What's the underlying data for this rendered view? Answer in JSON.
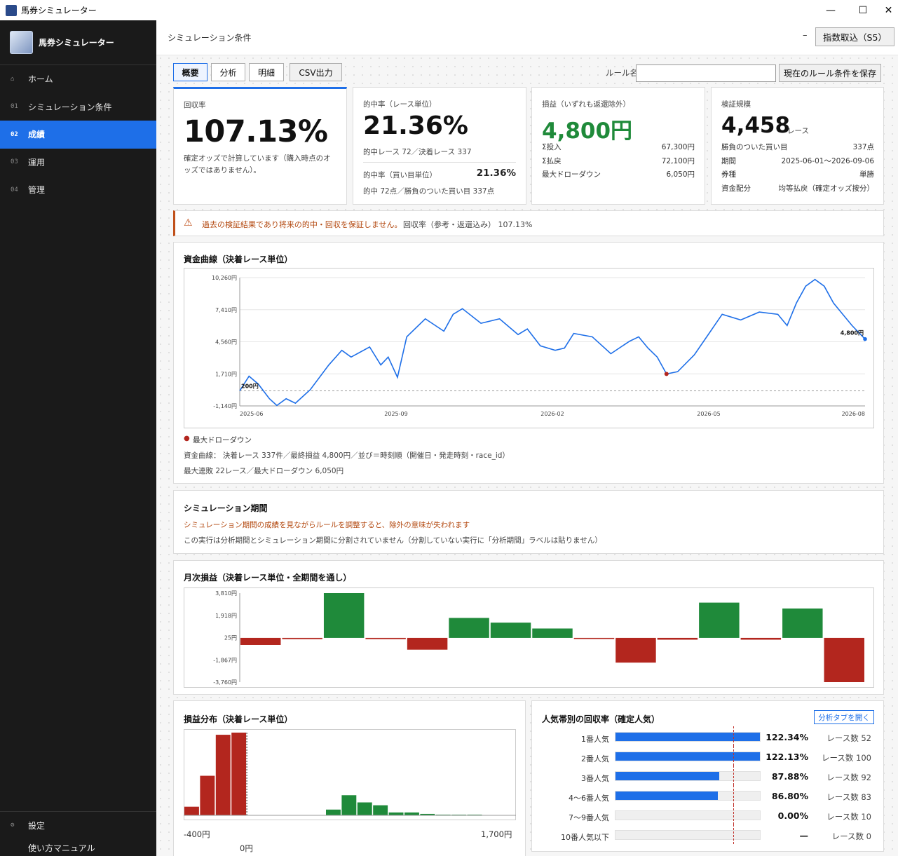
{
  "window": {
    "title": "馬券シミュレーター",
    "minimize": "—",
    "maximize": "☐",
    "close": "✕"
  },
  "sidebar": {
    "brand": "馬券シミュレーター",
    "items": [
      {
        "num": "",
        "label": "ホーム",
        "icon": "home-icon"
      },
      {
        "num": "01",
        "label": "シミュレーション条件"
      },
      {
        "num": "02",
        "label": "成績"
      },
      {
        "num": "03",
        "label": "運用"
      },
      {
        "num": "04",
        "label": "管理"
      }
    ],
    "settings": "設定",
    "manual": "使い方マニュアル"
  },
  "header": {
    "title": "シミュレーション条件",
    "minus": "–",
    "import_button": "指数取込（S5）"
  },
  "tabs": [
    {
      "label": "概要"
    },
    {
      "label": "分析"
    },
    {
      "label": "明細"
    }
  ],
  "csv_button": "CSV出力",
  "rule": {
    "label": "ルール名",
    "value": "",
    "save_button": "現在のルール条件を保存"
  },
  "kpi": {
    "roi": {
      "title": "回収率",
      "value": "107.13%",
      "note": "確定オッズで計算しています（購入時点のオッズではありません）。"
    },
    "hit": {
      "title": "的中率（レース単位）",
      "value": "21.36%",
      "sub": "的中レース 72／決着レース 337",
      "bet_label": "的中率（買い目単位）",
      "bet_value": "21.36%",
      "bet_sub": "的中 72点／勝負のついた買い目 337点"
    },
    "pl": {
      "title": "損益（いずれも返還除外）",
      "value": "4,800円",
      "rows": [
        {
          "k": "Σ投入",
          "v": "67,300円"
        },
        {
          "k": "Σ払戻",
          "v": "72,100円"
        },
        {
          "k": "最大ドローダウン",
          "v": "6,050円"
        }
      ]
    },
    "scale": {
      "title": "検証規模",
      "value": "4,458",
      "unit": "レース",
      "rows": [
        {
          "k": "勝負のついた買い目",
          "v": "337点"
        },
        {
          "k": "期間",
          "v": "2025-06-01～2026-09-06"
        },
        {
          "k": "券種",
          "v": "単勝"
        },
        {
          "k": "資金配分",
          "v": "均等払戻（確定オッズ按分）"
        }
      ]
    }
  },
  "warning": {
    "text": "過去の検証結果であり将来の的中・回収を保証しません。",
    "sub": "回収率（参考・返還込み） 107.13%"
  },
  "equity": {
    "title": "資金曲線（決着レース単位）",
    "legend": "最大ドローダウン",
    "info1": "資金曲線： 決着レース 337件／最終損益 4,800円／並び＝時刻順（開催日・発走時刻・race_id）",
    "info2": "最大連敗 22レース／最大ドローダウン 6,050円"
  },
  "period": {
    "title": "シミュレーション期間",
    "warn": "シミュレーション期間の成績を見ながらルールを調整すると、除外の意味が失われます",
    "note": "この実行は分析期間とシミュレーション期間に分割されていません（分割していない実行に「分析期間」ラベルは貼りません）"
  },
  "monthly": {
    "title": "月次損益（決着レース単位・全期間を通し）"
  },
  "dist": {
    "title": "損益分布（決着レース単位）",
    "xmin": "-400円",
    "xmax": "1,700円",
    "zero": "0円"
  },
  "pop": {
    "title": "人気帯別の回収率（確定人気）",
    "open_button": "分析タブを開く",
    "rows": [
      {
        "label": "1番人気",
        "rate": "122.34%",
        "count": "レース数 52",
        "pct": 122.34
      },
      {
        "label": "2番人気",
        "rate": "122.13%",
        "count": "レース数 100",
        "pct": 122.13
      },
      {
        "label": "3番人気",
        "rate": "87.88%",
        "count": "レース数 92",
        "pct": 87.88
      },
      {
        "label": "4～6番人気",
        "rate": "86.80%",
        "count": "レース数 83",
        "pct": 86.8
      },
      {
        "label": "7～9番人気",
        "rate": "0.00%",
        "count": "レース数 10",
        "pct": 0
      },
      {
        "label": "10番人気以下",
        "rate": "—",
        "count": "レース数 0",
        "pct": 0
      }
    ]
  },
  "chart_data": [
    {
      "type": "line",
      "title": "資金曲線（決着レース単位）",
      "yticks": [
        "10,260円",
        "7,410円",
        "4,560円",
        "1,710円",
        "-1,140円"
      ],
      "xticks": [
        "2025-06",
        "2025-09",
        "2026-02",
        "2026-05",
        "2026-08"
      ],
      "ylim": [
        -1140,
        10260
      ],
      "start_label": "200円",
      "end_label": "4,800円",
      "baseline": 200,
      "x": [
        0,
        5,
        10,
        16,
        20,
        25,
        30,
        38,
        48,
        55,
        60,
        70,
        76,
        80,
        85,
        90,
        100,
        110,
        115,
        120,
        130,
        140,
        150,
        155,
        162,
        170,
        175,
        180,
        190,
        200,
        210,
        215,
        220,
        225,
        230,
        236,
        245,
        255,
        260,
        270,
        280,
        290,
        295,
        300,
        305,
        310,
        315,
        320,
        325,
        330,
        337
      ],
      "y": [
        200,
        1500,
        800,
        -500,
        -1100,
        -500,
        -900,
        300,
        2500,
        3800,
        3200,
        4100,
        2500,
        3200,
        1400,
        5000,
        6600,
        5500,
        7000,
        7500,
        6200,
        6600,
        5200,
        5700,
        4200,
        3800,
        4000,
        5300,
        5000,
        3500,
        4600,
        5000,
        4000,
        3200,
        1700,
        1900,
        3400,
        5800,
        7000,
        6500,
        7200,
        7000,
        6000,
        8000,
        9500,
        10100,
        9500,
        8000,
        7000,
        6000,
        4800
      ],
      "drawdown_point": {
        "x": 230,
        "y": 1700
      }
    },
    {
      "type": "bar",
      "title": "月次損益（決着レース単位・全期間を通し）",
      "yticks": [
        "3,810円",
        "1,918円",
        "25円",
        "-1,867円",
        "-3,760円"
      ],
      "ylim": [
        -3760,
        3810
      ],
      "values": [
        -600,
        -100,
        3810,
        -100,
        -1000,
        1700,
        1300,
        800,
        -50,
        -2100,
        -150,
        3000,
        -150,
        2500,
        -3760
      ]
    },
    {
      "type": "bar",
      "title": "損益分布（決着レース単位）",
      "negative_counts": [
        12,
        55,
        112,
        115
      ],
      "positive_counts": [
        8,
        28,
        18,
        14,
        4,
        4,
        2,
        1,
        0,
        1
      ]
    }
  ]
}
